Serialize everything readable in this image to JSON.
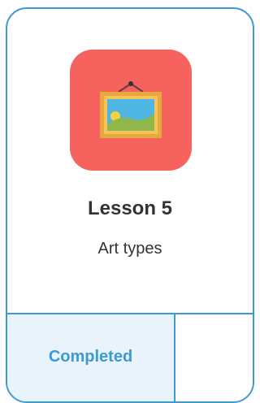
{
  "lesson_card": {
    "icon": "framed-picture-icon",
    "title": "Lesson 5",
    "subtitle": "Art types",
    "status": "Completed"
  },
  "colors": {
    "border": "#3d9ad1",
    "icon_background": "#f6625e",
    "status_background": "#e8f3fc",
    "status_text": "#3d9ad1",
    "title_text": "#333333"
  }
}
